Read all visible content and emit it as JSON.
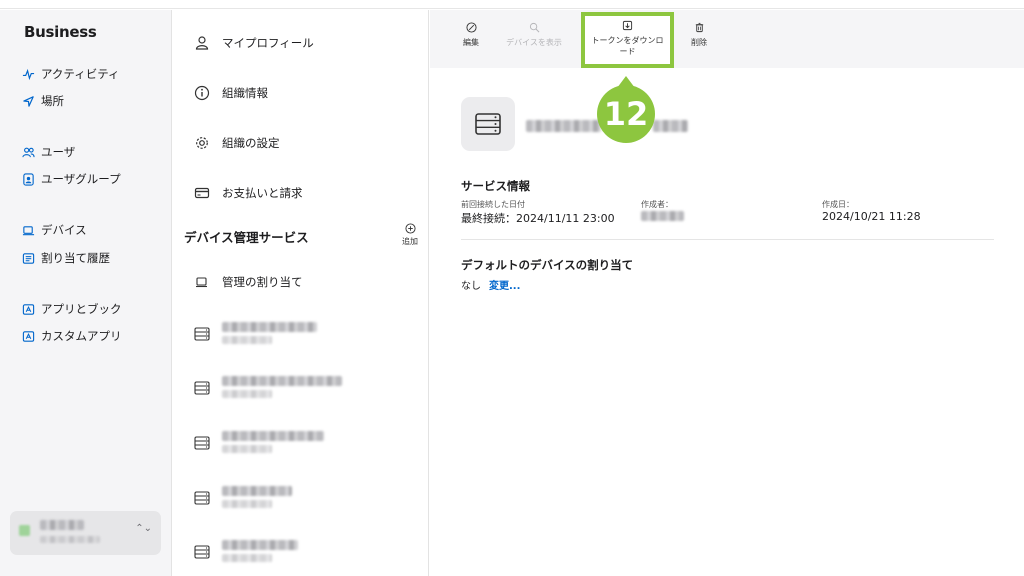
{
  "brand": {
    "apple": "",
    "name": "Business"
  },
  "sidebar": {
    "items": [
      {
        "label": "アクティビティ",
        "icon": "activity-icon"
      },
      {
        "label": "場所",
        "icon": "location-arrow-icon"
      },
      {
        "label": "ユーザ",
        "icon": "users-icon"
      },
      {
        "label": "ユーザグループ",
        "icon": "user-group-icon"
      },
      {
        "label": "デバイス",
        "icon": "laptop-icon"
      },
      {
        "label": "割り当て履歴",
        "icon": "list-icon"
      },
      {
        "label": "アプリとブック",
        "icon": "app-icon"
      },
      {
        "label": "カスタムアプリ",
        "icon": "custom-app-icon"
      }
    ],
    "account_chevron": "⌃⌄"
  },
  "middle": {
    "items": [
      {
        "label": "マイプロフィール",
        "icon": "person-icon"
      },
      {
        "label": "組織情報",
        "icon": "info-icon"
      },
      {
        "label": "組織の設定",
        "icon": "gear-icon"
      },
      {
        "label": "お支払いと請求",
        "icon": "credit-card-icon"
      }
    ],
    "section_title": "デバイス管理サービス",
    "add_label": "追加",
    "assign_label": "管理の割り当て",
    "server_rows": 5
  },
  "toolbar": {
    "edit": "編集",
    "show_devices": "デバイスを表示",
    "download_token_line1": "トークンをダウンロ",
    "download_token_line2": "ード",
    "delete": "削除"
  },
  "callout": {
    "number": "12"
  },
  "service": {
    "title": "サービス情報",
    "last_connected_label": "前回接続した日付",
    "last_connected_value": "最終接続：2024/11/11 23:00",
    "creator_label": "作成者：",
    "created_label": "作成日：",
    "created_value": "2024/10/21 11:28"
  },
  "default_assign": {
    "title": "デフォルトのデバイスの割り当て",
    "none": "なし",
    "change": "変更..."
  },
  "colors": {
    "highlight": "#8dc63f",
    "link": "#0066cc"
  }
}
